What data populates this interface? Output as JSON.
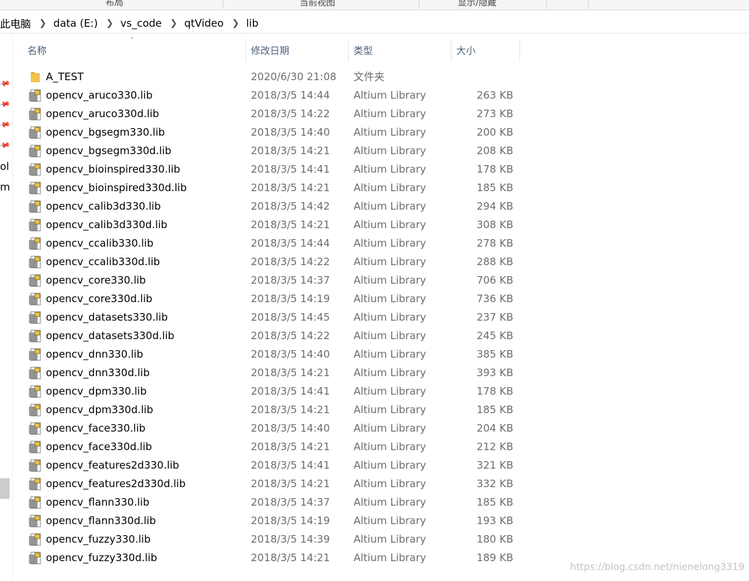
{
  "ribbon": {
    "groups": [
      "布局",
      "当前视图",
      "显示/隐藏"
    ]
  },
  "breadcrumb": {
    "items": [
      "此电脑",
      "data (E:)",
      "vs_code",
      "qtVideo",
      "lib"
    ]
  },
  "nav": {
    "fragments": [
      "ol",
      "m"
    ]
  },
  "columns": {
    "name": "名称",
    "date": "修改日期",
    "type": "类型",
    "size": "大小"
  },
  "files": [
    {
      "name": "A_TEST",
      "date": "2020/6/30 21:08",
      "type": "文件夹",
      "size": "",
      "icon": "folder-icon"
    },
    {
      "name": "opencv_aruco330.lib",
      "date": "2018/3/5 14:44",
      "type": "Altium Library",
      "size": "263 KB",
      "icon": "library-file-icon"
    },
    {
      "name": "opencv_aruco330d.lib",
      "date": "2018/3/5 14:22",
      "type": "Altium Library",
      "size": "273 KB",
      "icon": "library-file-icon"
    },
    {
      "name": "opencv_bgsegm330.lib",
      "date": "2018/3/5 14:40",
      "type": "Altium Library",
      "size": "200 KB",
      "icon": "library-file-icon"
    },
    {
      "name": "opencv_bgsegm330d.lib",
      "date": "2018/3/5 14:21",
      "type": "Altium Library",
      "size": "208 KB",
      "icon": "library-file-icon"
    },
    {
      "name": "opencv_bioinspired330.lib",
      "date": "2018/3/5 14:41",
      "type": "Altium Library",
      "size": "178 KB",
      "icon": "library-file-icon"
    },
    {
      "name": "opencv_bioinspired330d.lib",
      "date": "2018/3/5 14:21",
      "type": "Altium Library",
      "size": "185 KB",
      "icon": "library-file-icon"
    },
    {
      "name": "opencv_calib3d330.lib",
      "date": "2018/3/5 14:42",
      "type": "Altium Library",
      "size": "294 KB",
      "icon": "library-file-icon"
    },
    {
      "name": "opencv_calib3d330d.lib",
      "date": "2018/3/5 14:21",
      "type": "Altium Library",
      "size": "308 KB",
      "icon": "library-file-icon"
    },
    {
      "name": "opencv_ccalib330.lib",
      "date": "2018/3/5 14:44",
      "type": "Altium Library",
      "size": "278 KB",
      "icon": "library-file-icon"
    },
    {
      "name": "opencv_ccalib330d.lib",
      "date": "2018/3/5 14:22",
      "type": "Altium Library",
      "size": "288 KB",
      "icon": "library-file-icon"
    },
    {
      "name": "opencv_core330.lib",
      "date": "2018/3/5 14:37",
      "type": "Altium Library",
      "size": "706 KB",
      "icon": "library-file-icon"
    },
    {
      "name": "opencv_core330d.lib",
      "date": "2018/3/5 14:19",
      "type": "Altium Library",
      "size": "736 KB",
      "icon": "library-file-icon"
    },
    {
      "name": "opencv_datasets330.lib",
      "date": "2018/3/5 14:45",
      "type": "Altium Library",
      "size": "237 KB",
      "icon": "library-file-icon"
    },
    {
      "name": "opencv_datasets330d.lib",
      "date": "2018/3/5 14:22",
      "type": "Altium Library",
      "size": "245 KB",
      "icon": "library-file-icon"
    },
    {
      "name": "opencv_dnn330.lib",
      "date": "2018/3/5 14:40",
      "type": "Altium Library",
      "size": "385 KB",
      "icon": "library-file-icon"
    },
    {
      "name": "opencv_dnn330d.lib",
      "date": "2018/3/5 14:21",
      "type": "Altium Library",
      "size": "393 KB",
      "icon": "library-file-icon"
    },
    {
      "name": "opencv_dpm330.lib",
      "date": "2018/3/5 14:41",
      "type": "Altium Library",
      "size": "178 KB",
      "icon": "library-file-icon"
    },
    {
      "name": "opencv_dpm330d.lib",
      "date": "2018/3/5 14:21",
      "type": "Altium Library",
      "size": "185 KB",
      "icon": "library-file-icon"
    },
    {
      "name": "opencv_face330.lib",
      "date": "2018/3/5 14:40",
      "type": "Altium Library",
      "size": "204 KB",
      "icon": "library-file-icon"
    },
    {
      "name": "opencv_face330d.lib",
      "date": "2018/3/5 14:21",
      "type": "Altium Library",
      "size": "212 KB",
      "icon": "library-file-icon"
    },
    {
      "name": "opencv_features2d330.lib",
      "date": "2018/3/5 14:41",
      "type": "Altium Library",
      "size": "321 KB",
      "icon": "library-file-icon"
    },
    {
      "name": "opencv_features2d330d.lib",
      "date": "2018/3/5 14:21",
      "type": "Altium Library",
      "size": "332 KB",
      "icon": "library-file-icon"
    },
    {
      "name": "opencv_flann330.lib",
      "date": "2018/3/5 14:37",
      "type": "Altium Library",
      "size": "185 KB",
      "icon": "library-file-icon"
    },
    {
      "name": "opencv_flann330d.lib",
      "date": "2018/3/5 14:19",
      "type": "Altium Library",
      "size": "193 KB",
      "icon": "library-file-icon"
    },
    {
      "name": "opencv_fuzzy330.lib",
      "date": "2018/3/5 14:39",
      "type": "Altium Library",
      "size": "180 KB",
      "icon": "library-file-icon"
    },
    {
      "name": "opencv_fuzzy330d.lib",
      "date": "2018/3/5 14:21",
      "type": "Altium Library",
      "size": "189 KB",
      "icon": "library-file-icon"
    }
  ],
  "watermark": "https://blog.csdn.net/nienelong3319",
  "colors": {
    "header_text": "#4c607a",
    "secondary_text": "#6d6d6d",
    "folder": "#f4c24a"
  }
}
